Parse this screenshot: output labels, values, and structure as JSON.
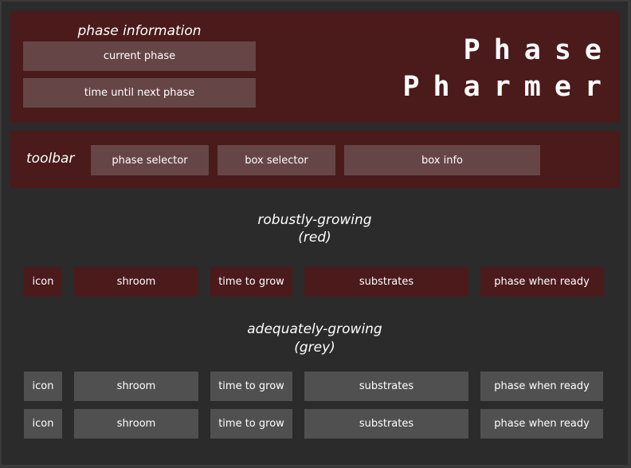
{
  "header": {
    "phase_information_label": "phase information",
    "current_phase_label": "current phase",
    "time_until_next_phase_label": "time until next phase",
    "title_line1": "Phase",
    "title_line2": "Pharmer"
  },
  "toolbar": {
    "label": "toolbar",
    "phase_selector_label": "phase selector",
    "box_selector_label": "box selector",
    "box_info_label": "box info"
  },
  "sections": {
    "red": {
      "title": "robustly-growing",
      "subtitle": "(red)",
      "color": "#4b1a1b",
      "rows": [
        {
          "icon": "icon",
          "shroom": "shroom",
          "time": "time to grow",
          "substrates": "substrates",
          "phase": "phase when ready"
        }
      ]
    },
    "grey": {
      "title": "adequately-growing",
      "subtitle": "(grey)",
      "color": "#505050",
      "rows": [
        {
          "icon": "icon",
          "shroom": "shroom",
          "time": "time to grow",
          "substrates": "substrates",
          "phase": "phase when ready"
        },
        {
          "icon": "icon",
          "shroom": "shroom",
          "time": "time to grow",
          "substrates": "substrates",
          "phase": "phase when ready"
        }
      ]
    }
  },
  "colors": {
    "panel": "#4b1a1b",
    "button": "#664546",
    "background": "#2b2b2b",
    "grey_cell": "#505050"
  }
}
